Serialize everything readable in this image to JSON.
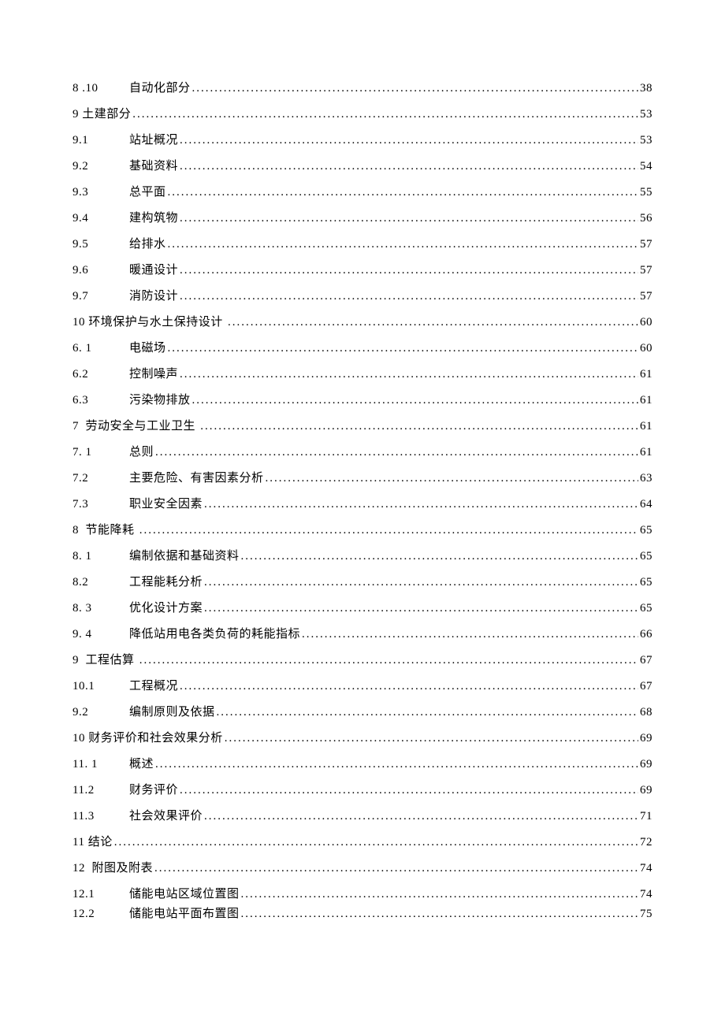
{
  "toc": [
    {
      "num": "8 .10",
      "title": "自动化部分",
      "page": "38",
      "indent": 1
    },
    {
      "num": "9 ",
      "title": "土建部分",
      "page": "53",
      "indent": 0
    },
    {
      "num": "9.1",
      "title": "站址概况",
      "page": "53",
      "indent": 1
    },
    {
      "num": "9.2",
      "title": "基础资料",
      "page": "54",
      "indent": 1
    },
    {
      "num": "9.3",
      "title": "总平面",
      "page": "55",
      "indent": 1
    },
    {
      "num": "9.4",
      "title": "建构筑物",
      "page": "56",
      "indent": 1
    },
    {
      "num": "9.5",
      "title": "给排水",
      "page": "57",
      "indent": 1
    },
    {
      "num": "9.6",
      "title": "暖通设计",
      "page": "57",
      "indent": 1
    },
    {
      "num": "9.7",
      "title": "消防设计",
      "page": "57",
      "indent": 1
    },
    {
      "num": "10 ",
      "title": "环境保护与水土保持设计 ",
      "page": "60",
      "indent": 0
    },
    {
      "num": "6. 1",
      "title": "电磁场",
      "page": "60",
      "indent": 1
    },
    {
      "num": "6.2",
      "title": "控制噪声",
      "page": "61",
      "indent": 1
    },
    {
      "num": "6.3",
      "title": "污染物排放",
      "page": "61",
      "indent": 1
    },
    {
      "num": "7  ",
      "title": "劳动安全与工业卫生 ",
      "page": "61",
      "indent": 0
    },
    {
      "num": "7. 1",
      "title": "总则",
      "page": "61",
      "indent": 1
    },
    {
      "num": "7.2",
      "title": "主要危险、有害因素分析",
      "page": "63",
      "indent": 1
    },
    {
      "num": "7.3",
      "title": "职业安全因素",
      "page": "64",
      "indent": 1
    },
    {
      "num": "8  ",
      "title": "节能降耗 ",
      "page": "65",
      "indent": 0
    },
    {
      "num": "8. 1",
      "title": "编制依据和基础资料",
      "page": "65",
      "indent": 1
    },
    {
      "num": "8.2",
      "title": "工程能耗分析",
      "page": "65",
      "indent": 1
    },
    {
      "num": "8. 3",
      "title": "优化设计方案",
      "page": "65",
      "indent": 1
    },
    {
      "num": "9. 4",
      "title": "降低站用电各类负荷的耗能指标",
      "page": "66",
      "indent": 1
    },
    {
      "num": "9  ",
      "title": "工程估算 ",
      "page": "67",
      "indent": 0
    },
    {
      "num": "10.1",
      "title": "工程概况",
      "page": "67",
      "indent": 1
    },
    {
      "num": "9.2",
      "title": "编制原则及依据",
      "page": "68",
      "indent": 1
    },
    {
      "num": "10 ",
      "title": "财务评价和社会效果分析",
      "page": "69",
      "indent": 0
    },
    {
      "num": "11. 1",
      "title": "概述",
      "page": "69",
      "indent": 1
    },
    {
      "num": "11.2",
      "title": "财务评价",
      "page": "69",
      "indent": 1
    },
    {
      "num": "11.3",
      "title": "社会效果评价",
      "page": "71",
      "indent": 1
    },
    {
      "num": "11 ",
      "title": "结论",
      "page": "72",
      "indent": 0
    },
    {
      "num": "12  ",
      "title": "附图及附表",
      "page": "74",
      "indent": 0
    },
    {
      "num": "12.1",
      "title": "储能电站区域位置图",
      "page": "74",
      "indent": 1,
      "tight": true
    },
    {
      "num": "12.2",
      "title": "储能电站平面布置图",
      "page": "75",
      "indent": 1
    }
  ]
}
